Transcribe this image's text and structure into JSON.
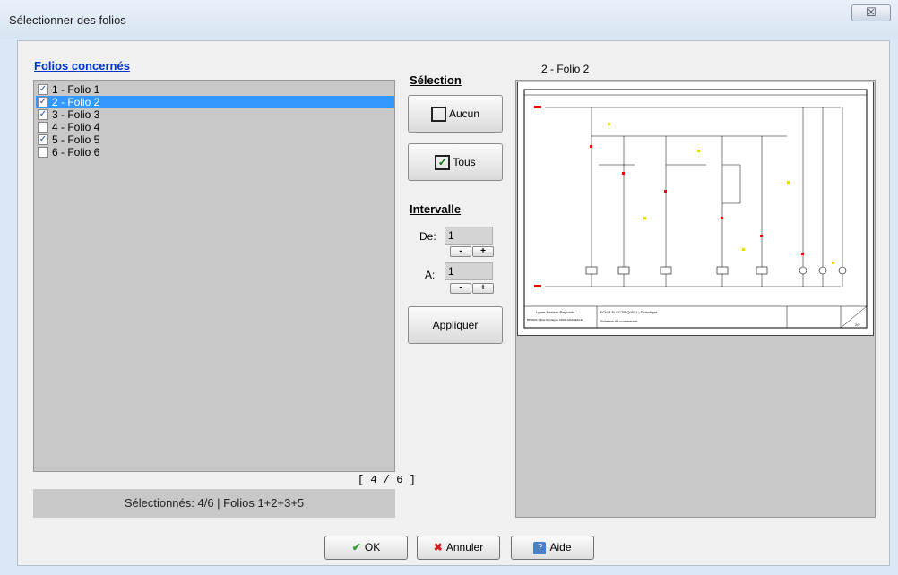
{
  "window": {
    "title": "Sélectionner des folios",
    "close_glyph": "☒"
  },
  "folios": {
    "heading": "Folios concernés",
    "items": [
      {
        "label": "1 - Folio 1",
        "checked": true,
        "selected": false
      },
      {
        "label": "2 - Folio 2",
        "checked": true,
        "selected": true
      },
      {
        "label": "3 - Folio 3",
        "checked": true,
        "selected": false
      },
      {
        "label": "4 - Folio 4",
        "checked": false,
        "selected": false
      },
      {
        "label": "5 - Folio 5",
        "checked": true,
        "selected": false
      },
      {
        "label": "6 - Folio 6",
        "checked": false,
        "selected": false
      }
    ],
    "count": "[ 4 / 6 ]",
    "status": "Sélectionnés: 4/6  |  Folios 1+2+3+5"
  },
  "selection": {
    "heading": "Sélection",
    "none_label": "Aucun",
    "all_label": "Tous",
    "check_glyph": "✓"
  },
  "interval": {
    "heading": "Intervalle",
    "from_label": "De:",
    "from_value": "1",
    "to_label": "A:",
    "to_value": "1",
    "minus": "-",
    "plus": "+",
    "apply_label": "Appliquer"
  },
  "preview": {
    "title": "2 - Folio 2",
    "sheet": {
      "company": "Lycée Pasteur Beyfonds",
      "address": "BP 3020 1 Rue Montaigne 13500 MARSEILLE",
      "project": "FOUR ELECTRIQUE 1 | Didactique",
      "subtitle": "Schéma de commande",
      "folio_no": "2/2"
    }
  },
  "footer": {
    "ok": "OK",
    "cancel": "Annuler",
    "help": "Aide"
  }
}
